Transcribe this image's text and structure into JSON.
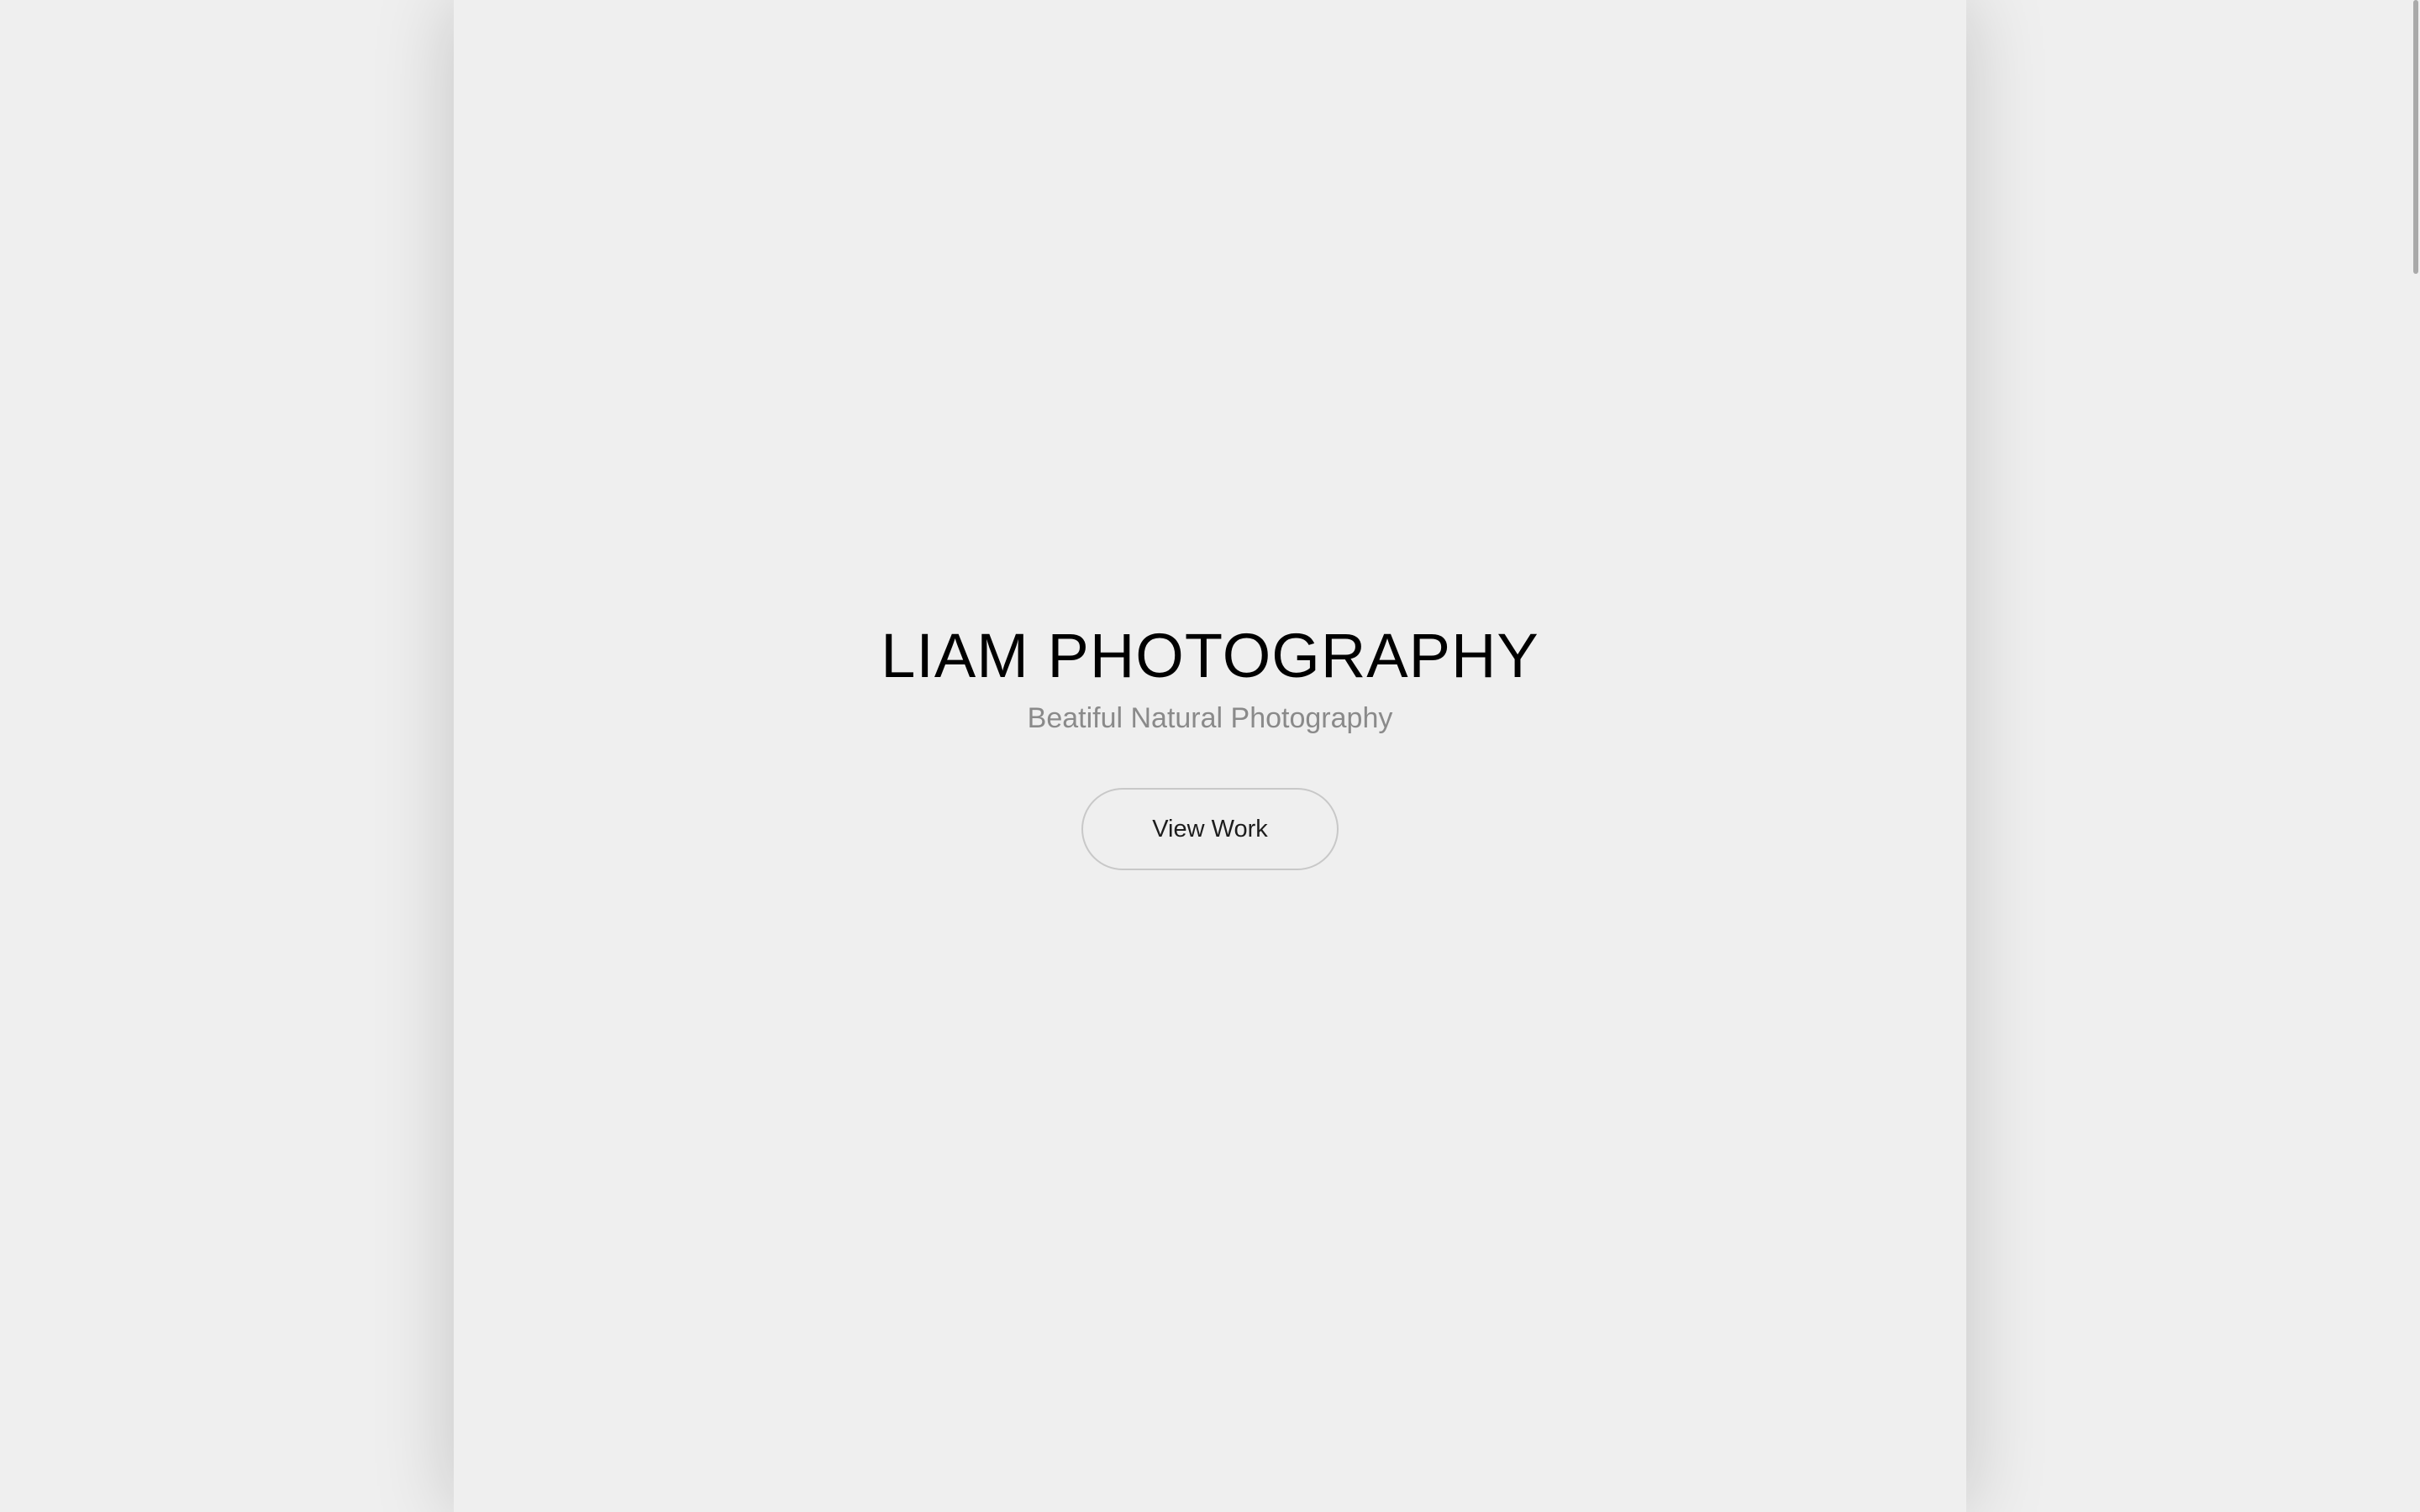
{
  "hero": {
    "title": "LIAM PHOTOGRAPHY",
    "tagline": "Beatiful Natural Photography",
    "cta_label": "View Work"
  },
  "colors": {
    "background": "#efefef",
    "title": "#000000",
    "tagline": "#8a8a8a",
    "button_border": "#c8c8c8",
    "button_text": "#1d1d1d"
  }
}
